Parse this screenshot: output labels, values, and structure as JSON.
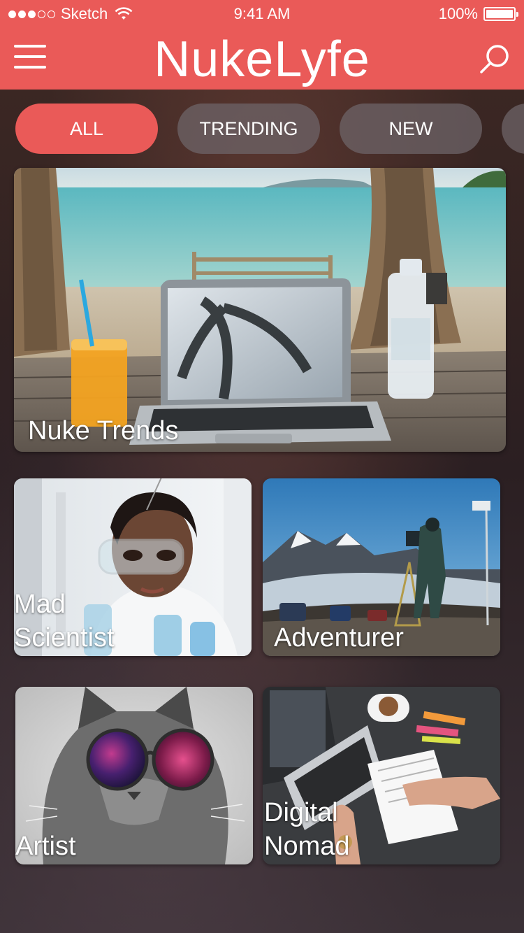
{
  "status_bar": {
    "carrier": "Sketch",
    "time": "9:41 AM",
    "battery": "100%",
    "signal_bars_filled": 3,
    "signal_bars_total": 5
  },
  "header": {
    "title": "NukeLyfe",
    "menu_icon": "hamburger-menu-icon",
    "search_icon": "search-icon",
    "color": "#ea5a58"
  },
  "filters": [
    {
      "label": "ALL",
      "active": true
    },
    {
      "label": "TRENDING",
      "active": false
    },
    {
      "label": "NEW",
      "active": false
    }
  ],
  "cards": {
    "trends": {
      "label": "Nuke Trends"
    },
    "mad_scientist": {
      "label_line1": "Mad",
      "label_line2": "Scientist"
    },
    "adventurer": {
      "label": "Adventurer"
    },
    "artist": {
      "label": "Artist"
    },
    "digital_nomad": {
      "label_line1": "Digital",
      "label_line2": "Nomad"
    }
  }
}
